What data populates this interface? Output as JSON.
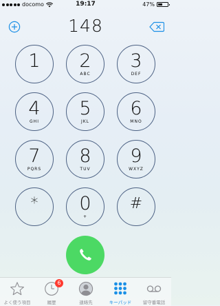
{
  "status_bar": {
    "carrier": "docomo",
    "time": "19:17",
    "battery": "47%",
    "battery_level": 0.47
  },
  "dialer": {
    "number": "148"
  },
  "keypad": [
    {
      "digit": "1",
      "letters": ""
    },
    {
      "digit": "2",
      "letters": "ABC"
    },
    {
      "digit": "3",
      "letters": "DEF"
    },
    {
      "digit": "4",
      "letters": "GHI"
    },
    {
      "digit": "5",
      "letters": "JKL"
    },
    {
      "digit": "6",
      "letters": "MNO"
    },
    {
      "digit": "7",
      "letters": "PQRS"
    },
    {
      "digit": "8",
      "letters": "TUV"
    },
    {
      "digit": "9",
      "letters": "WXYZ"
    },
    {
      "digit": "*",
      "letters": ""
    },
    {
      "digit": "0",
      "letters": "+"
    },
    {
      "digit": "#",
      "letters": ""
    }
  ],
  "tab_bar": {
    "tabs": [
      {
        "label": "よく使う項目",
        "icon": "star-icon"
      },
      {
        "label": "履歴",
        "icon": "clock-icon",
        "badge": "6"
      },
      {
        "label": "連絡先",
        "icon": "contact-icon"
      },
      {
        "label": "キーパッド",
        "icon": "keypad-icon",
        "active": true
      },
      {
        "label": "留守番電話",
        "icon": "voicemail-icon"
      }
    ]
  },
  "colors": {
    "call_green": "#4cd964",
    "accent_blue": "#1a8fe6",
    "key_ring": "#4c6183",
    "badge_red": "#ff3b30"
  }
}
